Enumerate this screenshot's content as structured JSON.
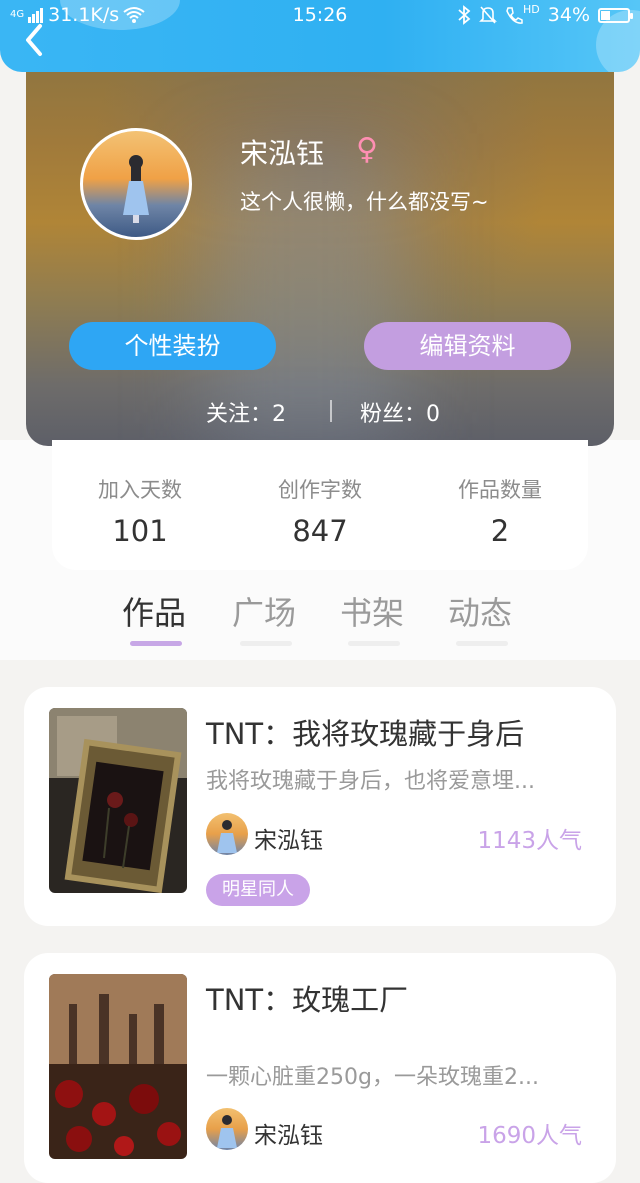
{
  "status_bar": {
    "network": "4G",
    "speed": "31.1K/s",
    "time": "15:26",
    "hd": "HD",
    "battery": "34%",
    "battery_level": 0.34
  },
  "profile": {
    "name": "宋泓钰",
    "gender_symbol": "♀",
    "bio": "这个人很懒，什么都没写~",
    "dress_button": "个性装扮",
    "edit_button": "编辑资料",
    "following": "关注：2",
    "followers": "粉丝：0"
  },
  "stats": [
    {
      "label": "加入天数",
      "value": "101"
    },
    {
      "label": "创作字数",
      "value": "847"
    },
    {
      "label": "作品数量",
      "value": "2"
    }
  ],
  "tabs": [
    {
      "label": "作品",
      "active": true
    },
    {
      "label": "广场",
      "active": false
    },
    {
      "label": "书架",
      "active": false
    },
    {
      "label": "动态",
      "active": false
    }
  ],
  "works": [
    {
      "title": "TNT：我将玫瑰藏于身后",
      "desc": "我将玫瑰藏于身后，也将爱意埋...",
      "author": "宋泓钰",
      "popularity": "1143人气",
      "tag": "明星同人"
    },
    {
      "title": "TNT：玫瑰工厂",
      "desc": "一颗心脏重250g，一朵玫瑰重2...",
      "author": "宋泓钰",
      "popularity": "1690人气"
    }
  ],
  "colors": {
    "topbar": "#2fb0f2",
    "dress_button": "#2ea6f4",
    "edit_button": "#c39ee0",
    "accent_purple": "#c9a3e8",
    "gender": "#ff8fb3"
  }
}
